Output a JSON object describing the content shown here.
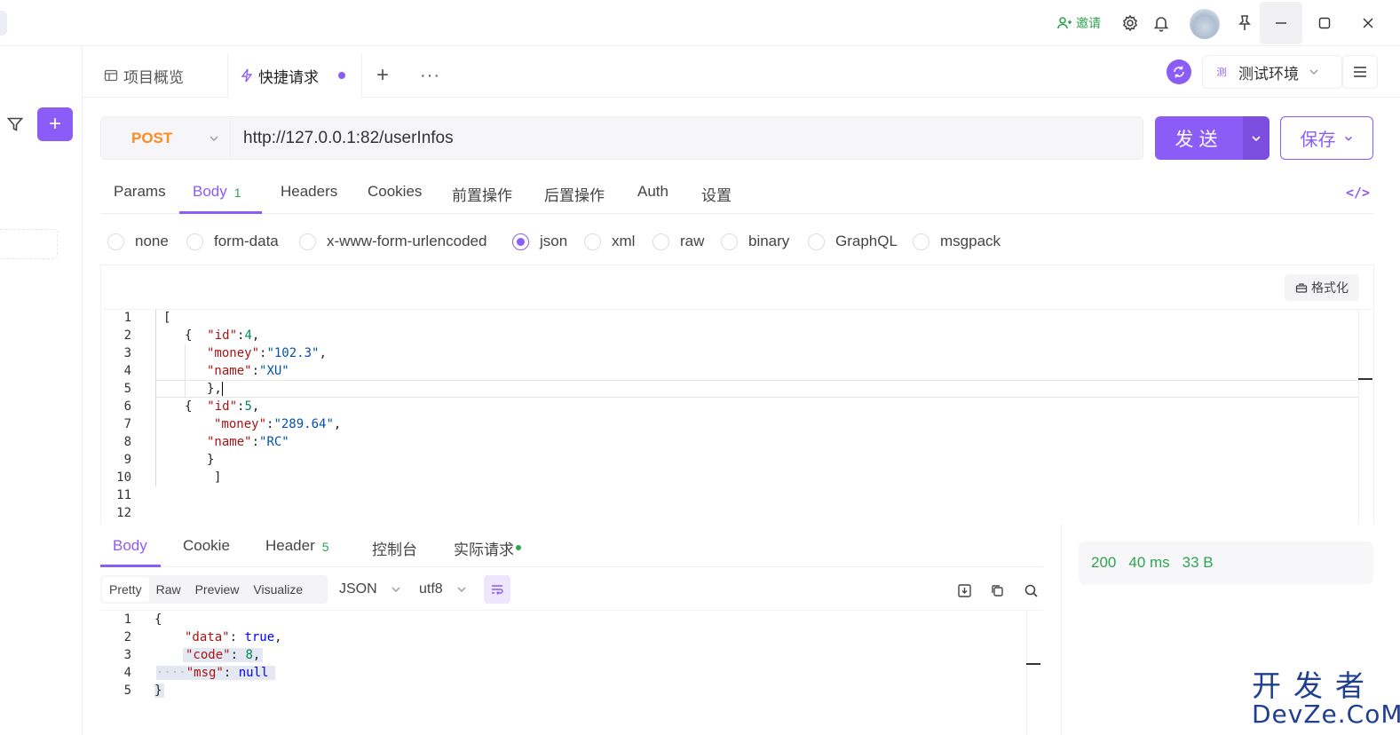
{
  "titlebar": {
    "invite_label": "邀请"
  },
  "tabs": [
    {
      "label": "项目概览"
    },
    {
      "label": "快捷请求"
    }
  ],
  "environment": {
    "badge": "测",
    "label": "测试环境"
  },
  "request": {
    "method": "POST",
    "url": "http://127.0.0.1:82/userInfos",
    "send_label": "发送",
    "save_label": "保存"
  },
  "request_tabs": [
    {
      "label": "Params",
      "badge": ""
    },
    {
      "label": "Body",
      "badge": "1"
    },
    {
      "label": "Headers",
      "badge": ""
    },
    {
      "label": "Cookies",
      "badge": ""
    },
    {
      "label": "前置操作",
      "badge": ""
    },
    {
      "label": "后置操作",
      "badge": ""
    },
    {
      "label": "Auth",
      "badge": ""
    },
    {
      "label": "设置",
      "badge": ""
    }
  ],
  "body_types": [
    "none",
    "form-data",
    "x-www-form-urlencoded",
    "json",
    "xml",
    "raw",
    "binary",
    "GraphQL",
    "msgpack"
  ],
  "body_type_selected": "json",
  "format_label": "格式化",
  "request_body_lines": [
    "1",
    "2",
    "3",
    "4",
    "5",
    "6",
    "7",
    "8",
    "9",
    "10",
    "11",
    "12"
  ],
  "response": {
    "tabs": [
      {
        "label": "Body",
        "badge": ""
      },
      {
        "label": "Cookie",
        "badge": ""
      },
      {
        "label": "Header",
        "badge": "5"
      },
      {
        "label": "控制台",
        "badge": ""
      },
      {
        "label": "实际请求",
        "badge": ""
      }
    ],
    "view_modes": [
      "Pretty",
      "Raw",
      "Preview",
      "Visualize"
    ],
    "format": "JSON",
    "encoding": "utf8",
    "lines": [
      "1",
      "2",
      "3",
      "4",
      "5"
    ],
    "status": "200",
    "time": "40 ms",
    "size": "33 B"
  },
  "watermark": {
    "cn": "开发者",
    "en": "DevZe.CoM"
  },
  "colors": {
    "accent": "#8b5cf6",
    "method": "#ff8a1f",
    "status": "#2ea44f"
  }
}
